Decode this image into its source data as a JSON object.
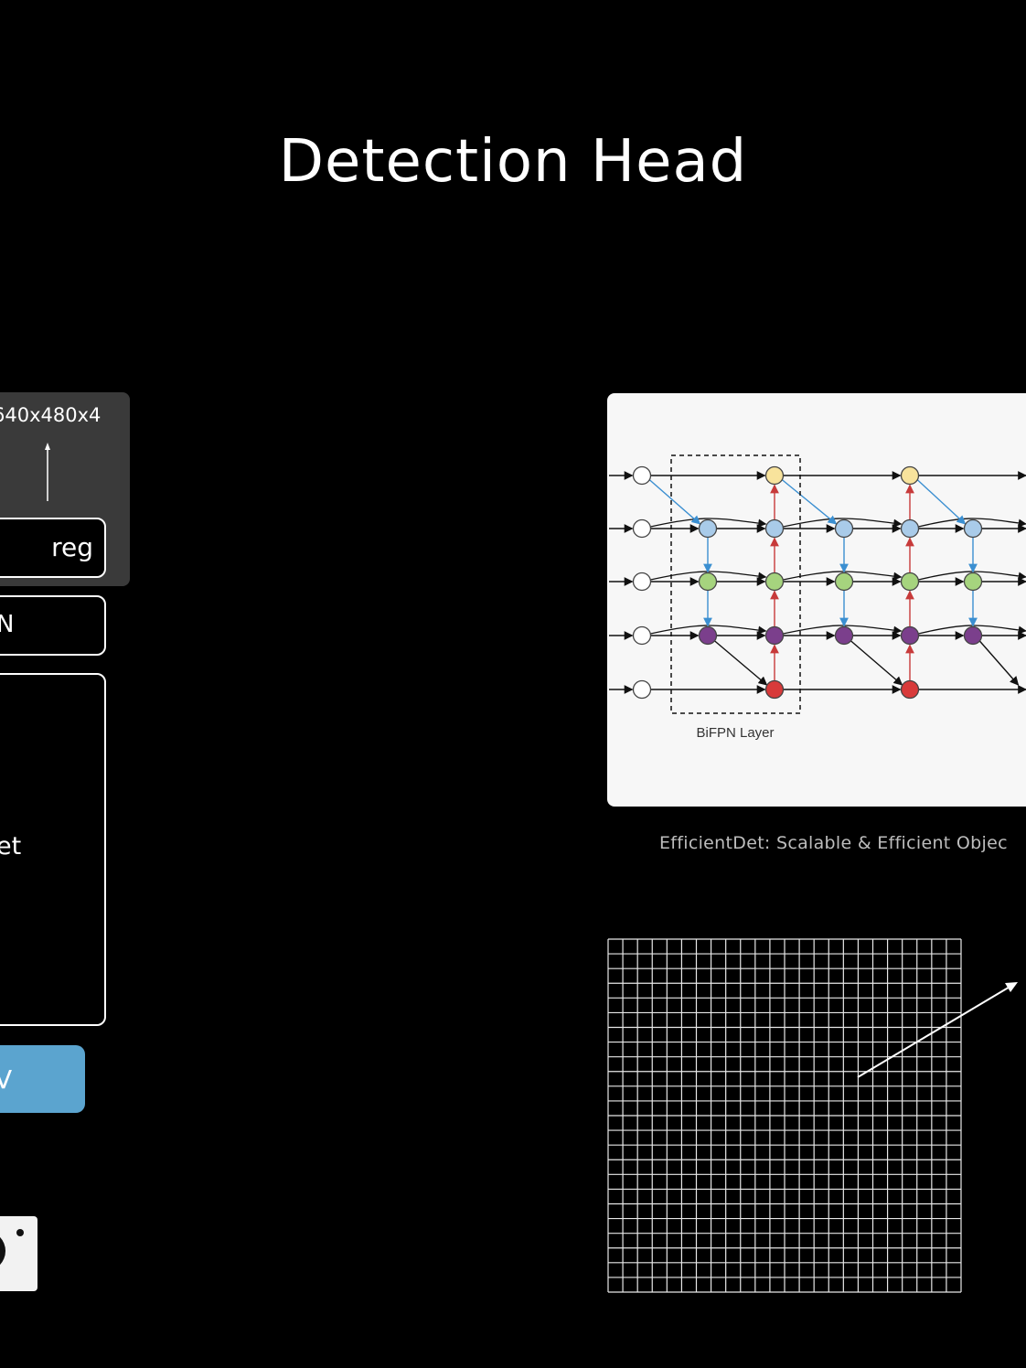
{
  "slide": {
    "title": "Detection Head"
  },
  "architecture": {
    "output_dims": "640x480x4",
    "head_label": "reg",
    "neck_label": "N",
    "backbone_label": "et",
    "input_label": "V",
    "input_color": "#5ba4cf"
  },
  "bifpn": {
    "layer_label": "BiFPN Layer",
    "caption": "EfficientDet: Scalable & Efficient Objec",
    "node_colors": {
      "input": "#ffffff",
      "p7": "#f8e39c",
      "p6": "#a9cbe9",
      "p5": "#a6d47e",
      "p4": "#7b3f8c",
      "p3": "#d83a3a"
    },
    "edge_colors": {
      "top_down": "#3b8fd1",
      "bottom_up": "#c73a3a",
      "lateral": "#111111"
    }
  },
  "icons": {
    "camera": "camera-icon",
    "up_arrow": "arrow-up-icon",
    "diag_arrow": "arrow-up-right-icon"
  }
}
